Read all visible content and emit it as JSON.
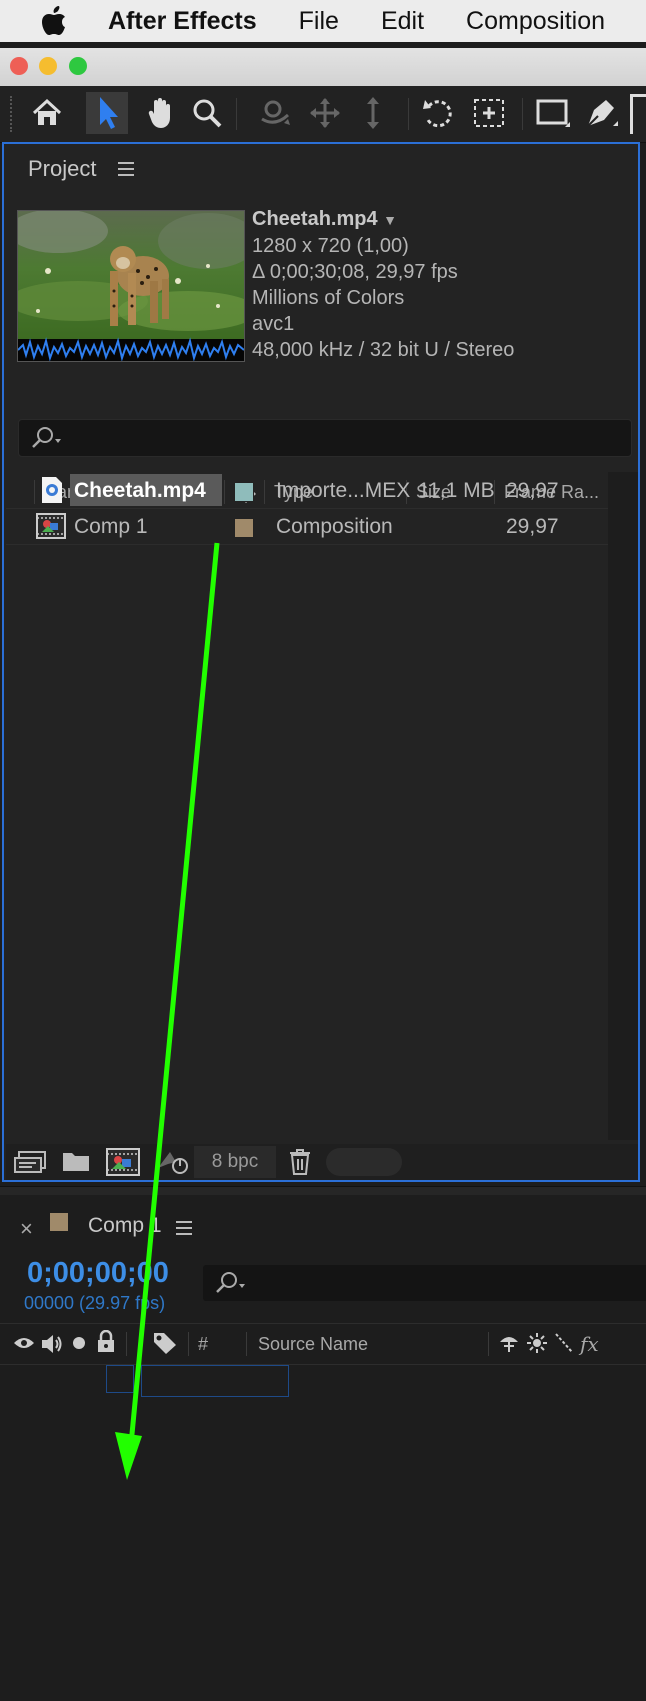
{
  "menubar": {
    "app_name": "After Effects",
    "items": [
      "File",
      "Edit",
      "Composition"
    ]
  },
  "toolbar": {
    "tools": [
      "home-icon",
      "selection-arrow-icon",
      "hand-icon",
      "zoom-icon",
      "orbit-camera-icon",
      "pan-camera-icon",
      "dolly-camera-icon",
      "rotate-icon",
      "pan-behind-icon",
      "rectangle-icon",
      "pen-icon"
    ]
  },
  "project": {
    "title": "Project",
    "preview": {
      "filename": "Cheetah.mp4",
      "dimensions": "1280 x 720 (1,00)",
      "duration": "Δ 0;00;30;08, 29,97 fps",
      "colors": "Millions of Colors",
      "codec": "avc1",
      "audio": "48,000 kHz / 32 bit U / Stereo"
    },
    "columns": {
      "name": "Name",
      "type": "Type",
      "size": "Size",
      "frame_rate": "Frame Ra..."
    },
    "items": [
      {
        "name": "Cheetah.mp4",
        "type": "Importe...MEX",
        "size": "11,1 MB",
        "frame_rate": "29,97",
        "label_color": "#8fbcbb"
      },
      {
        "name": "Comp 1",
        "type": "Composition",
        "size": "",
        "frame_rate": "29,97",
        "label_color": "#a08a6a"
      }
    ],
    "footer": {
      "bpc": "8 bpc"
    }
  },
  "timeline": {
    "tab_label": "Comp 1",
    "close_glyph": "×",
    "timecode": "0;00;00;00",
    "frame_info": "00000 (29.97 fps)",
    "columns": {
      "number": "#",
      "source_name": "Source Name",
      "fx": "fx"
    }
  },
  "colors": {
    "accent_blue": "#2b6fd6",
    "timecode_blue": "#3d8ee6",
    "drag_arrow": "#22ff00"
  }
}
